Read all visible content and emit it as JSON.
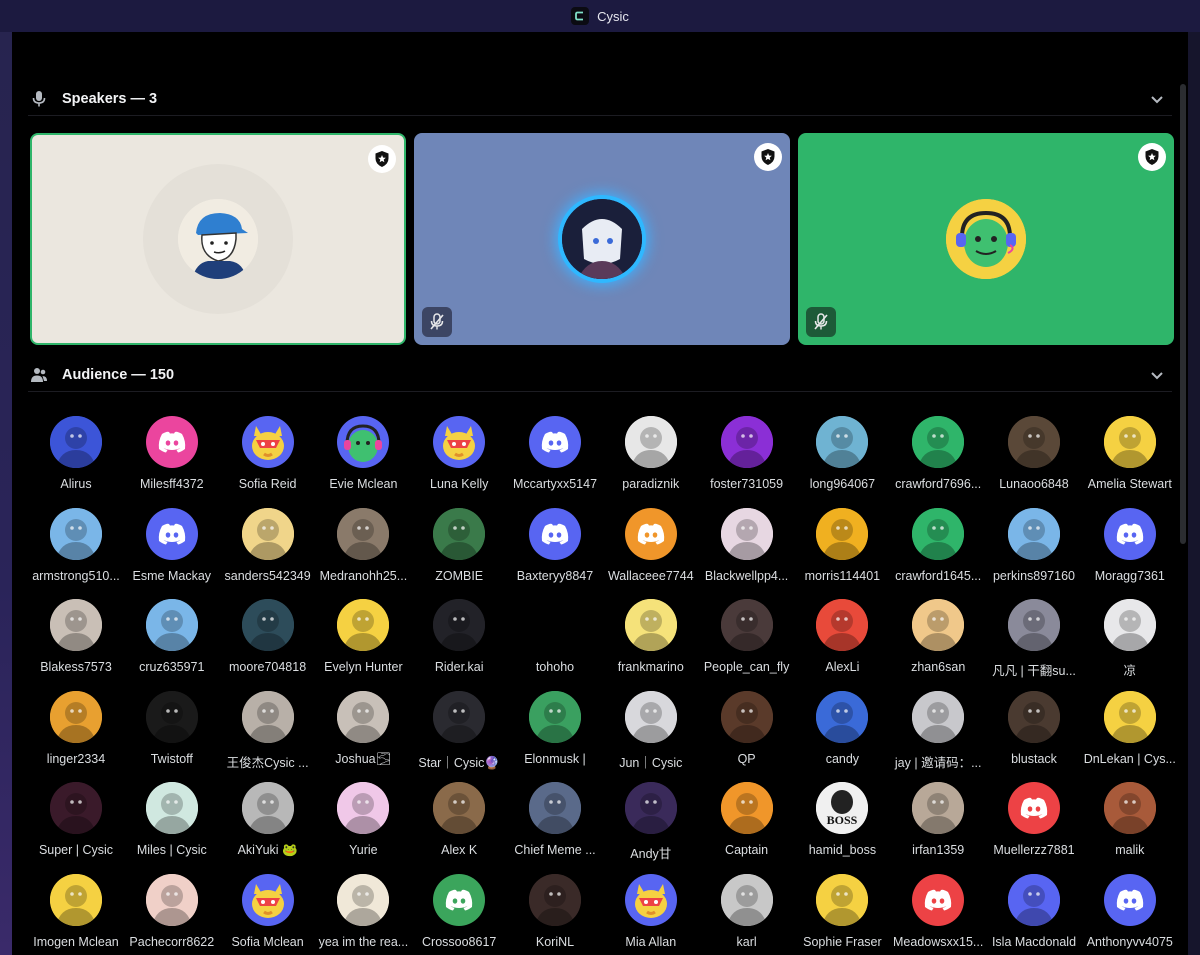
{
  "window": {
    "title": "Cysic"
  },
  "speakers": {
    "heading": "Speakers — 3",
    "tiles": [
      {
        "bg": "#ebe7df",
        "avatar": "bluecap-face",
        "avatarBg": "#f1ece2",
        "muted": false,
        "active": true
      },
      {
        "bg": "#6f86b8",
        "avatar": "glowing-portal-girl",
        "avatarBg": "#1a1f3a",
        "muted": true,
        "active": false
      },
      {
        "bg": "#2fb56a",
        "avatar": "green-headset-creature",
        "avatarBg": "#f5d142",
        "muted": true,
        "active": false
      }
    ]
  },
  "audience": {
    "heading": "Audience — 150",
    "members": [
      {
        "name": "Alirus",
        "color": "#3c55d8",
        "kind": "photo"
      },
      {
        "name": "Milesff4372",
        "color": "#eb459e",
        "kind": "discord"
      },
      {
        "name": "Sofia Reid",
        "color": "#5865f2",
        "kind": "duck"
      },
      {
        "name": "Evie Mclean",
        "color": "#5865f2",
        "kind": "headset"
      },
      {
        "name": "Luna Kelly",
        "color": "#5865f2",
        "kind": "duck"
      },
      {
        "name": "Mccartyxx5147",
        "color": "#5865f2",
        "kind": "discord"
      },
      {
        "name": "paradiznik",
        "color": "#e7e7e7",
        "kind": "photo"
      },
      {
        "name": "foster731059",
        "color": "#8b2fd6",
        "kind": "photo"
      },
      {
        "name": "long964067",
        "color": "#6fb3d2",
        "kind": "photo"
      },
      {
        "name": "crawford7696...",
        "color": "#2fb56a",
        "kind": "photo"
      },
      {
        "name": "Lunaoo6848",
        "color": "#5a4838",
        "kind": "photo"
      },
      {
        "name": "Amelia Stewart",
        "color": "#f5d142",
        "kind": "photo"
      },
      {
        "name": "armstrong510...",
        "color": "#7ab6e8",
        "kind": "photo"
      },
      {
        "name": "Esme Mackay",
        "color": "#5865f2",
        "kind": "discord"
      },
      {
        "name": "sanders542349",
        "color": "#f0d58a",
        "kind": "photo"
      },
      {
        "name": "Medranohh25...",
        "color": "#8a7a6a",
        "kind": "photo"
      },
      {
        "name": "ZOMBIE",
        "color": "#3a7a4a",
        "kind": "photo"
      },
      {
        "name": "Baxteryy8847",
        "color": "#5865f2",
        "kind": "discord"
      },
      {
        "name": "Wallaceee7744",
        "color": "#f0962a",
        "kind": "discord"
      },
      {
        "name": "Blackwellpp4...",
        "color": "#e7d7e2",
        "kind": "photo"
      },
      {
        "name": "morris114401",
        "color": "#f0b020",
        "kind": "photo"
      },
      {
        "name": "crawford1645...",
        "color": "#2fb56a",
        "kind": "photo"
      },
      {
        "name": "perkins897160",
        "color": "#7ab6e8",
        "kind": "photo"
      },
      {
        "name": "Moragg7361",
        "color": "#5865f2",
        "kind": "discord"
      },
      {
        "name": "Blakess7573",
        "color": "#c9bfb6",
        "kind": "photo"
      },
      {
        "name": "cruz635971",
        "color": "#7ab6e8",
        "kind": "photo"
      },
      {
        "name": "moore704818",
        "color": "#2d4c5a",
        "kind": "photo"
      },
      {
        "name": "Evelyn Hunter",
        "color": "#f5d142",
        "kind": "photo"
      },
      {
        "name": "Rider.kai",
        "color": "#222228",
        "kind": "photo"
      },
      {
        "name": "tohoho",
        "color": "#000000",
        "kind": "blank"
      },
      {
        "name": "frankmarino",
        "color": "#f5e27a",
        "kind": "photo"
      },
      {
        "name": "People_can_fly",
        "color": "#4a3a3a",
        "kind": "photo"
      },
      {
        "name": "AlexLi",
        "color": "#e84a3a",
        "kind": "photo"
      },
      {
        "name": "zhan6san",
        "color": "#f0c88a",
        "kind": "photo"
      },
      {
        "name": "凡凡 | 干翻su...",
        "color": "#8a8a9a",
        "kind": "photo"
      },
      {
        "name": "凉",
        "color": "#e8e8ea",
        "kind": "photo"
      },
      {
        "name": "linger2334",
        "color": "#e8a030",
        "kind": "photo"
      },
      {
        "name": "Twistoff",
        "color": "#1a1a1a",
        "kind": "photo"
      },
      {
        "name": "王俊杰Cysic ...",
        "color": "#b8b0a8",
        "kind": "photo"
      },
      {
        "name": "Joshua🌫",
        "color": "#c8c0b8",
        "kind": "photo"
      },
      {
        "name": "Star｜Cysic🔮",
        "color": "#2a2a30",
        "kind": "photo"
      },
      {
        "name": "Elonmusk |",
        "color": "#3aa060",
        "kind": "photo"
      },
      {
        "name": "Jun｜Cysic",
        "color": "#d8d8dc",
        "kind": "photo"
      },
      {
        "name": "QP",
        "color": "#5a3a2a",
        "kind": "photo"
      },
      {
        "name": "candy",
        "color": "#3a6ad8",
        "kind": "photo"
      },
      {
        "name": "jay | 邀请码：...",
        "color": "#c8c8cc",
        "kind": "photo"
      },
      {
        "name": "blustack",
        "color": "#4a3a30",
        "kind": "photo"
      },
      {
        "name": "DnLekan | Cys...",
        "color": "#f5d142",
        "kind": "photo"
      },
      {
        "name": "Super | Cysic",
        "color": "#3a1a2a",
        "kind": "photo"
      },
      {
        "name": "Miles | Cysic",
        "color": "#d0e8e0",
        "kind": "photo"
      },
      {
        "name": "AkiYuki 🐸",
        "color": "#b8b8b8",
        "kind": "photo"
      },
      {
        "name": "Yurie",
        "color": "#f0c8e8",
        "kind": "photo"
      },
      {
        "name": "Alex K",
        "color": "#8a6a4a",
        "kind": "photo"
      },
      {
        "name": "Chief Meme ...",
        "color": "#5a6a8a",
        "kind": "photo"
      },
      {
        "name": "Andy甘",
        "color": "#3a2a5a",
        "kind": "photo"
      },
      {
        "name": "Captain",
        "color": "#f0962a",
        "kind": "photo"
      },
      {
        "name": "hamid_boss",
        "color": "#f0f0f0",
        "kind": "boss"
      },
      {
        "name": "irfan1359",
        "color": "#b8a898",
        "kind": "photo"
      },
      {
        "name": "Muellerzz7881",
        "color": "#ed4245",
        "kind": "discord"
      },
      {
        "name": "malik",
        "color": "#a85a3a",
        "kind": "photo"
      },
      {
        "name": "Imogen Mclean",
        "color": "#f5d142",
        "kind": "photo"
      },
      {
        "name": "Pachecorr8622",
        "color": "#f0d0c8",
        "kind": "photo"
      },
      {
        "name": "Sofia Mclean",
        "color": "#5865f2",
        "kind": "duck"
      },
      {
        "name": "yea im the rea...",
        "color": "#f0e8d8",
        "kind": "photo"
      },
      {
        "name": "Crossoo8617",
        "color": "#3ba55c",
        "kind": "discord"
      },
      {
        "name": "KoriNL",
        "color": "#3a2a28",
        "kind": "photo"
      },
      {
        "name": "Mia Allan",
        "color": "#5865f2",
        "kind": "duck"
      },
      {
        "name": "karl",
        "color": "#c8c8c8",
        "kind": "photo"
      },
      {
        "name": "Sophie Fraser",
        "color": "#f5d142",
        "kind": "photo"
      },
      {
        "name": "Meadowsxx15...",
        "color": "#ed4245",
        "kind": "discord"
      },
      {
        "name": "Isla Macdonald",
        "color": "#5865f2",
        "kind": "photo"
      },
      {
        "name": "Anthonyvv4075",
        "color": "#5865f2",
        "kind": "discord"
      }
    ]
  }
}
